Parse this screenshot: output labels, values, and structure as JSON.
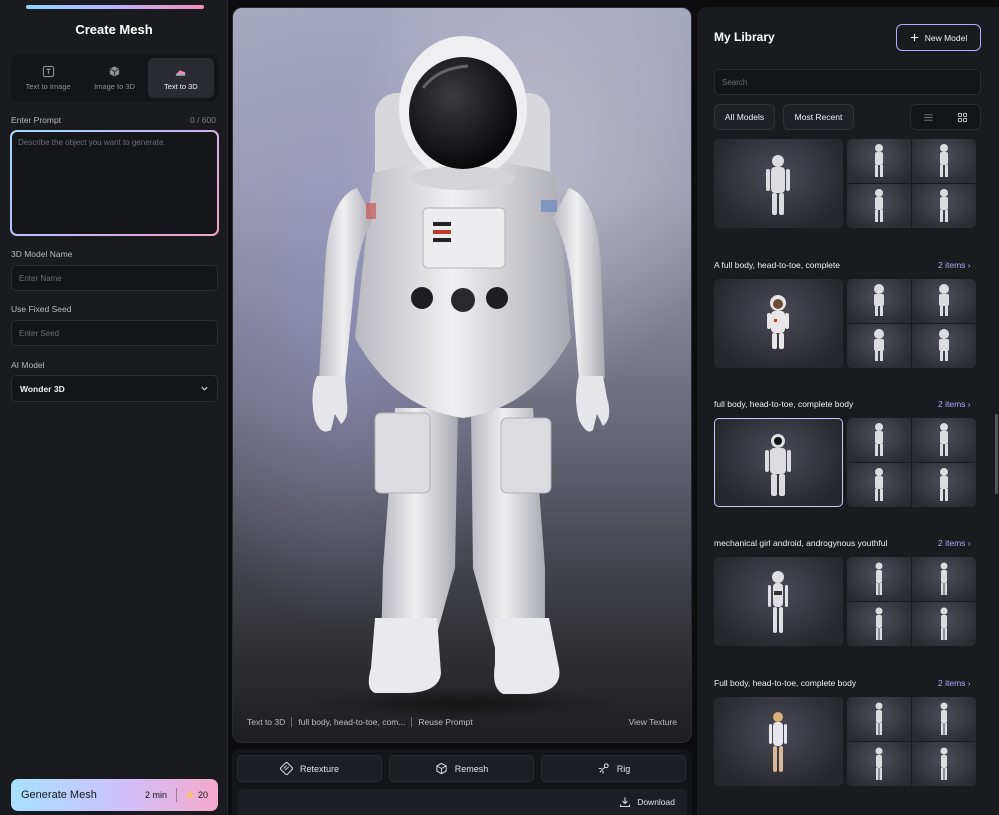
{
  "left_panel": {
    "title": "Create Mesh",
    "modes": [
      {
        "label": "Text to Image",
        "icon": "text-image-icon",
        "active": false
      },
      {
        "label": "Image to 3D",
        "icon": "cube-icon",
        "active": false
      },
      {
        "label": "Text to 3D",
        "icon": "shoe-icon",
        "active": true
      }
    ],
    "prompt": {
      "label": "Enter Prompt",
      "counter": "0 / 600",
      "placeholder": "Describe the object you want to generate.",
      "value": ""
    },
    "model_name": {
      "label": "3D Model Name",
      "placeholder": "Enter Name"
    },
    "seed": {
      "label": "Use Fixed Seed",
      "placeholder": "Enter Seed"
    },
    "ai_model": {
      "label": "AI Model",
      "value": "Wonder 3D"
    },
    "generate": {
      "label": "Generate Mesh",
      "time": "2 min",
      "credits": "20"
    }
  },
  "viewer": {
    "footer": {
      "mode": "Text to 3D",
      "prompt_excerpt": "full body, head-to-toe, com...",
      "reuse": "Reuse Prompt",
      "view_texture": "View Texture"
    }
  },
  "toolbar": {
    "retexture": "Retexture",
    "remesh": "Remesh",
    "rig": "Rig",
    "download": "Download"
  },
  "library": {
    "title": "My Library",
    "new_model": "New Model",
    "search_placeholder": "Search",
    "filters": [
      "All Models",
      "Most Recent"
    ],
    "groups": [
      {
        "title": "",
        "count": ""
      },
      {
        "title": "A full body, head-to-toe, complete",
        "count": "2 items"
      },
      {
        "title": "full body, head-to-toe, complete body",
        "count": "2 items"
      },
      {
        "title": "mechanical girl android, androgynous youthful",
        "count": "2 items"
      },
      {
        "title": "Full body, head-to-toe, complete body",
        "count": "2 items"
      }
    ]
  },
  "colors": {
    "accent": "#b6a7ff",
    "gradient_start": "#a8e1ff",
    "gradient_end": "#f6a9cc"
  }
}
